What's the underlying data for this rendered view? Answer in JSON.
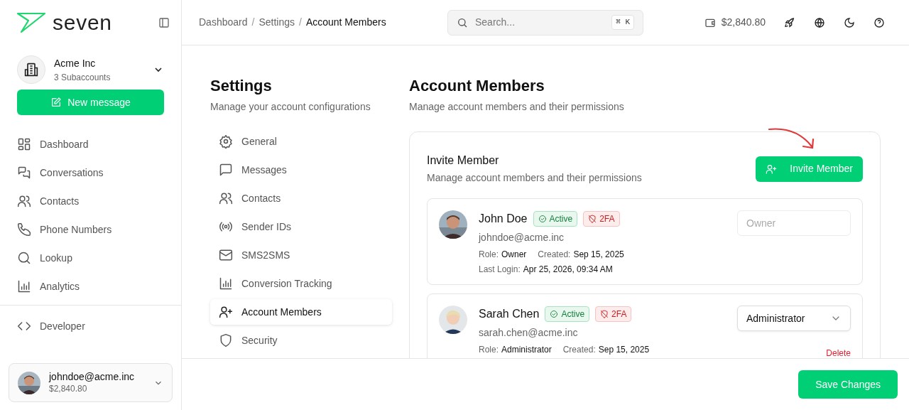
{
  "logo": {
    "text": "seven"
  },
  "account": {
    "name": "Acme Inc",
    "subtitle": "3 Subaccounts"
  },
  "new_message": {
    "label": "New message"
  },
  "nav": {
    "main": [
      {
        "label": "Dashboard"
      },
      {
        "label": "Conversations"
      },
      {
        "label": "Contacts"
      },
      {
        "label": "Phone Numbers"
      },
      {
        "label": "Lookup"
      },
      {
        "label": "Analytics"
      }
    ],
    "secondary": [
      {
        "label": "Developer"
      }
    ]
  },
  "user": {
    "email": "johndoe@acme.inc",
    "balance": "$2,840.80"
  },
  "breadcrumbs": [
    {
      "label": "Dashboard",
      "current": false
    },
    {
      "label": "Settings",
      "current": false
    },
    {
      "label": "Account Members",
      "current": true
    }
  ],
  "breadcrumb_separator": "/",
  "search": {
    "placeholder": "Search...",
    "shortcut": "⌘ K"
  },
  "balance": "$2,840.80",
  "settings": {
    "title": "Settings",
    "subtitle": "Manage your account configurations",
    "items": [
      {
        "label": "General",
        "selected": false
      },
      {
        "label": "Messages",
        "selected": false
      },
      {
        "label": "Contacts",
        "selected": false
      },
      {
        "label": "Sender IDs",
        "selected": false
      },
      {
        "label": "SMS2SMS",
        "selected": false
      },
      {
        "label": "Conversion Tracking",
        "selected": false
      },
      {
        "label": "Account Members",
        "selected": true
      },
      {
        "label": "Security",
        "selected": false
      }
    ]
  },
  "page": {
    "title": "Account Members",
    "subtitle": "Manage account members and their permissions"
  },
  "invite": {
    "title": "Invite Member",
    "subtitle": "Manage account members and their permissions",
    "button": "Invite Member"
  },
  "members": [
    {
      "name": "John Doe",
      "status": "Active",
      "twofa": "2FA",
      "email": "johndoe@acme.inc",
      "role_label": "Role:",
      "role": "Owner",
      "created_label": "Created:",
      "created": "Sep 15, 2025",
      "last_login_label": "Last Login:",
      "last_login": "Apr 25, 2026, 09:34 AM",
      "role_select": {
        "value": "Owner",
        "disabled": true
      }
    },
    {
      "name": "Sarah Chen",
      "status": "Active",
      "twofa": "2FA",
      "email": "sarah.chen@acme.inc",
      "role_label": "Role:",
      "role": "Administrator",
      "created_label": "Created:",
      "created": "Sep 15, 2025",
      "role_select": {
        "value": "Administrator",
        "disabled": false
      },
      "delete_label": "Delete"
    }
  ],
  "footer": {
    "button": "Save Changes"
  }
}
